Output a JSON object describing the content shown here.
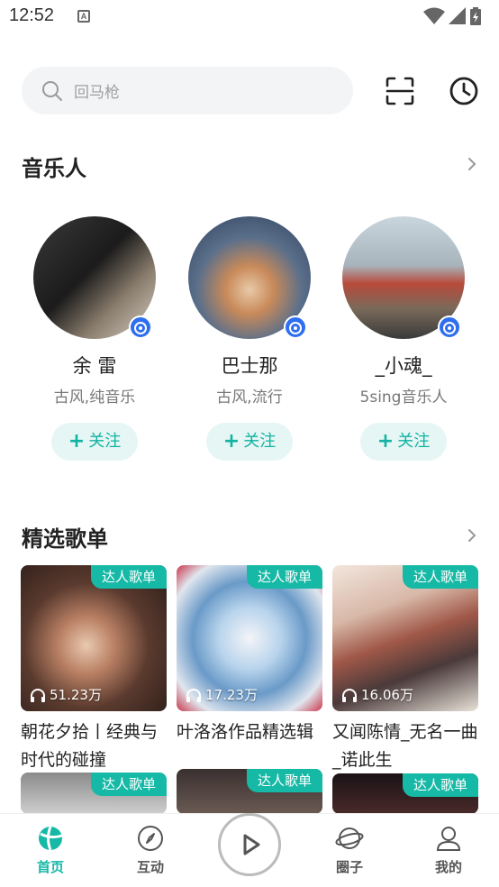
{
  "status_bar": {
    "time": "12:52",
    "notification_letter": "A"
  },
  "search": {
    "placeholder": "回马枪"
  },
  "musicians": {
    "title": "音乐人",
    "artists": [
      {
        "name": "余 雷",
        "tags": "古风,纯音乐",
        "follow_label": "关注"
      },
      {
        "name": "巴士那",
        "tags": "古风,流行",
        "follow_label": "关注"
      },
      {
        "name": "_小魂_",
        "tags": "5sing音乐人",
        "follow_label": "关注"
      }
    ]
  },
  "playlists": {
    "title": "精选歌单",
    "items": [
      {
        "badge": "达人歌单",
        "plays": "51.23万",
        "title": "朝花夕拾丨经典与时代的碰撞"
      },
      {
        "badge": "达人歌单",
        "plays": "17.23万",
        "title": "叶洛洛作品精选辑"
      },
      {
        "badge": "达人歌单",
        "plays": "16.06万",
        "title": "又闻陈情_无名一曲_诺此生"
      },
      {
        "badge": "达人歌单"
      },
      {
        "badge": "达人歌单"
      },
      {
        "badge": "达人歌单"
      }
    ]
  },
  "bottom_nav": {
    "home": "首页",
    "interact": "互动",
    "circle": "圈子",
    "mine": "我的"
  },
  "colors": {
    "accent": "#16b9a6"
  }
}
